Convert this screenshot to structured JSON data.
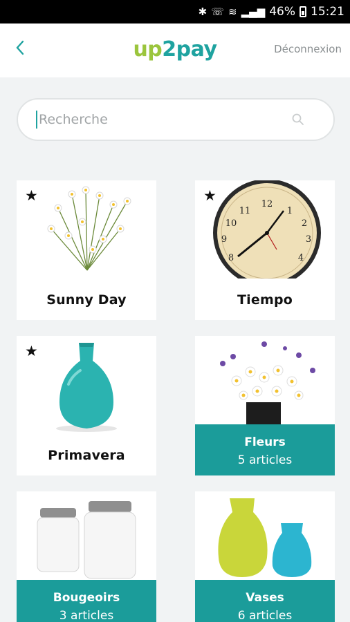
{
  "status": {
    "battery": "46%",
    "time": "15:21"
  },
  "header": {
    "logo_part1": "up",
    "logo_part2": "2pay",
    "logout": "Déconnexion"
  },
  "search": {
    "placeholder": "Recherche"
  },
  "cards": [
    {
      "title": "Sunny Day",
      "starred": true
    },
    {
      "title": "Tiempo",
      "starred": true
    },
    {
      "title": "Primavera",
      "starred": true
    },
    {
      "title": "Fleurs",
      "count": "5 articles"
    },
    {
      "title": "Bougeoirs",
      "count": "3 articles"
    },
    {
      "title": "Vases",
      "count": "6 articles"
    }
  ],
  "colors": {
    "accent": "#1b9c9a",
    "logo_green": "#9bc53d",
    "background": "#f1f3f4"
  }
}
